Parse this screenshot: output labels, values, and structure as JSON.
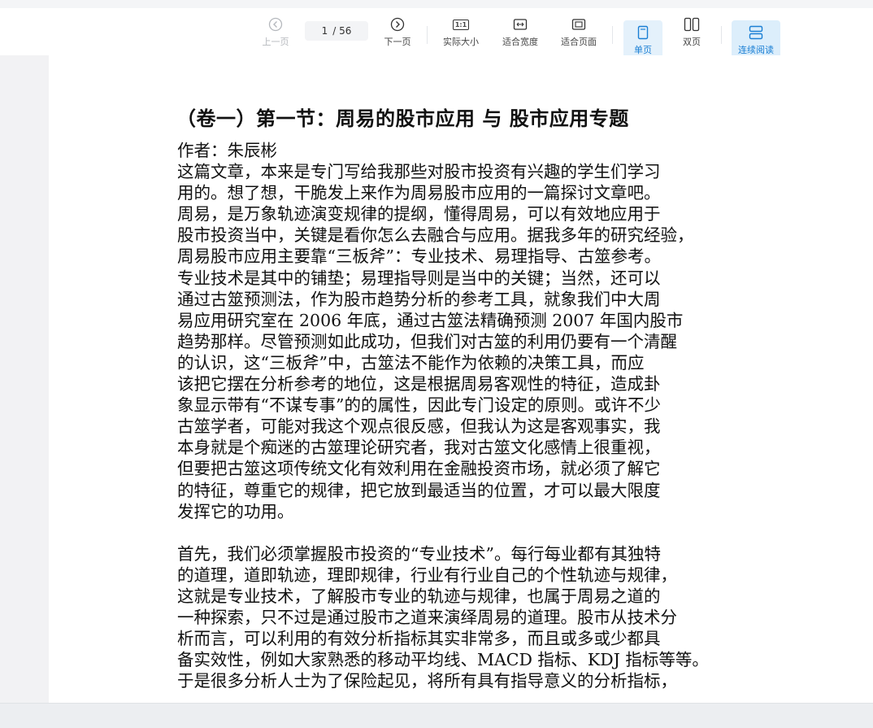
{
  "toolbar": {
    "prev_label": "上一页",
    "next_label": "下一页",
    "current_page": "1",
    "total_pages": "/ 56",
    "actual_size_label": "实际大小",
    "fit_width_label": "适合宽度",
    "fit_page_label": "适合页面",
    "single_page_label": "单页",
    "double_page_label": "双页",
    "continuous_label": "连续阅读",
    "actual_size_icon_text": "1:1"
  },
  "icons": {
    "prev": "chevron-left-circle-icon",
    "next": "chevron-right-circle-icon",
    "actual_size": "one-to-one-icon",
    "fit_width": "fit-width-icon",
    "fit_page": "fit-page-icon",
    "single_page": "single-page-icon",
    "double_page": "double-page-icon",
    "continuous": "continuous-scroll-icon"
  },
  "colors": {
    "accent": "#1a7fd4",
    "active_bg": "#e4f1fb"
  },
  "document": {
    "title": "（卷一）第一节：周易的股市应用 与 股市应用专题",
    "lines": [
      "作者：朱辰彬",
      "这篇文章，本来是专门写给我那些对股市投资有兴趣的学生们学习",
      "用的。想了想，干脆发上来作为周易股市应用的一篇探讨文章吧。",
      "周易，是万象轨迹演变规律的提纲，懂得周易，可以有效地应用于",
      "股市投资当中，关键是看你怎么去融合与应用。据我多年的研究经验，",
      "周易股市应用主要靠“三板斧”：专业技术、易理指导、古筮参考。",
      "专业技术是其中的铺垫；易理指导则是当中的关键；当然，还可以",
      "通过古筮预测法，作为股市趋势分析的参考工具，就象我们中大周",
      "易应用研究室在 2006 年底，通过古筮法精确预测 2007 年国内股市",
      "趋势那样。尽管预测如此成功，但我们对古筮的利用仍要有一个清醒",
      "的认识，这“三板斧”中，古筮法不能作为依赖的决策工具，而应",
      "该把它摆在分析参考的地位，这是根据周易客观性的特征，造成卦",
      "象显示带有“不谋专事”的的属性，因此专门设定的原则。或许不少",
      "古筮学者，可能对我这个观点很反感，但我认为这是客观事实，我",
      "本身就是个痴迷的古筮理论研究者，我对古筮文化感情上很重视，",
      "但要把古筮这项传统文化有效利用在金融投资市场，就必须了解它",
      "的特征，尊重它的规律，把它放到最适当的位置，才可以最大限度",
      "发挥它的功用。",
      "",
      "首先，我们必须掌握股市投资的“专业技术”。每行每业都有其独特",
      "的道理，道即轨迹，理即规律，行业有行业自己的个性轨迹与规律，",
      "这就是专业技术，了解股市专业的轨迹与规律，也属于周易之道的",
      "一种探索，只不过是通过股市之道来演绎周易的道理。股市从技术分",
      "析而言，可以利用的有效分析指标其实非常多，而且或多或少都具",
      "备实效性，例如大家熟悉的移动平均线、MACD 指标、KDJ 指标等等。",
      "于是很多分析人士为了保险起见，将所有具有指导意义的分析指标，"
    ]
  }
}
